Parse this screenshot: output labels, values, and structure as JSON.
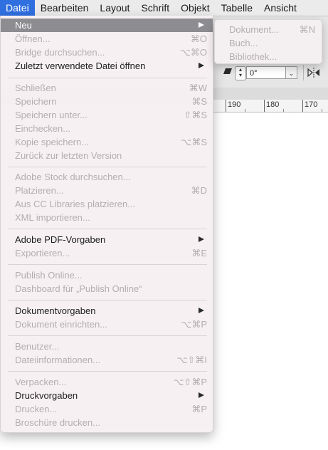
{
  "menubar": {
    "items": [
      "Datei",
      "Bearbeiten",
      "Layout",
      "Schrift",
      "Objekt",
      "Tabelle",
      "Ansicht"
    ],
    "active": "Datei"
  },
  "file_menu": {
    "items": [
      {
        "label": "Neu",
        "shortcut": "",
        "submenu": true,
        "enabled": true,
        "highlighted": true
      },
      {
        "label": "Öffnen...",
        "shortcut": "⌘O",
        "enabled": false
      },
      {
        "label": "Bridge durchsuchen...",
        "shortcut": "⌥⌘O",
        "enabled": false
      },
      {
        "label": "Zuletzt verwendete Datei öffnen",
        "shortcut": "",
        "submenu": true,
        "enabled": true
      },
      {
        "label": "Schließen",
        "shortcut": "⌘W",
        "enabled": false
      },
      {
        "label": "Speichern",
        "shortcut": "⌘S",
        "enabled": false
      },
      {
        "label": "Speichern unter...",
        "shortcut": "⇧⌘S",
        "enabled": false
      },
      {
        "label": "Einchecken...",
        "shortcut": "",
        "enabled": false
      },
      {
        "label": "Kopie speichern...",
        "shortcut": "⌥⌘S",
        "enabled": false
      },
      {
        "label": "Zurück zur letzten Version",
        "shortcut": "",
        "enabled": false
      },
      {
        "label": "Adobe Stock durchsuchen...",
        "shortcut": "",
        "enabled": false
      },
      {
        "label": "Platzieren...",
        "shortcut": "⌘D",
        "enabled": false
      },
      {
        "label": "Aus CC Libraries platzieren...",
        "shortcut": "",
        "enabled": false
      },
      {
        "label": "XML importieren...",
        "shortcut": "",
        "enabled": false
      },
      {
        "label": "Adobe PDF-Vorgaben",
        "shortcut": "",
        "submenu": true,
        "enabled": true
      },
      {
        "label": "Exportieren...",
        "shortcut": "⌘E",
        "enabled": false
      },
      {
        "label": "Publish Online...",
        "shortcut": "",
        "enabled": false
      },
      {
        "label": "Dashboard für „Publish Online“",
        "shortcut": "",
        "enabled": false
      },
      {
        "label": "Dokumentvorgaben",
        "shortcut": "",
        "submenu": true,
        "enabled": true
      },
      {
        "label": "Dokument einrichten...",
        "shortcut": "⌥⌘P",
        "enabled": false
      },
      {
        "label": "Benutzer...",
        "shortcut": "",
        "enabled": false
      },
      {
        "label": "Dateiinformationen...",
        "shortcut": "⌥⇧⌘I",
        "enabled": false
      },
      {
        "label": "Verpacken...",
        "shortcut": "⌥⇧⌘P",
        "enabled": false
      },
      {
        "label": "Druckvorgaben",
        "shortcut": "",
        "submenu": true,
        "enabled": true
      },
      {
        "label": "Drucken...",
        "shortcut": "⌘P",
        "enabled": false
      },
      {
        "label": "Broschüre drucken...",
        "shortcut": "",
        "enabled": false
      }
    ]
  },
  "new_submenu": {
    "items": [
      {
        "label": "Dokument...",
        "shortcut": "⌘N",
        "enabled": false
      },
      {
        "label": "Buch...",
        "shortcut": "",
        "enabled": false
      },
      {
        "label": "Bibliothek...",
        "shortcut": "",
        "enabled": false
      }
    ]
  },
  "control_panel": {
    "angle_value": "0°"
  },
  "ruler": {
    "labels": [
      "190",
      "180",
      "170"
    ]
  },
  "colors": {
    "menubar_active": "#2f6fe0",
    "menu_highlight": "#8d8c91",
    "disabled_text": "#b3aeb0"
  }
}
